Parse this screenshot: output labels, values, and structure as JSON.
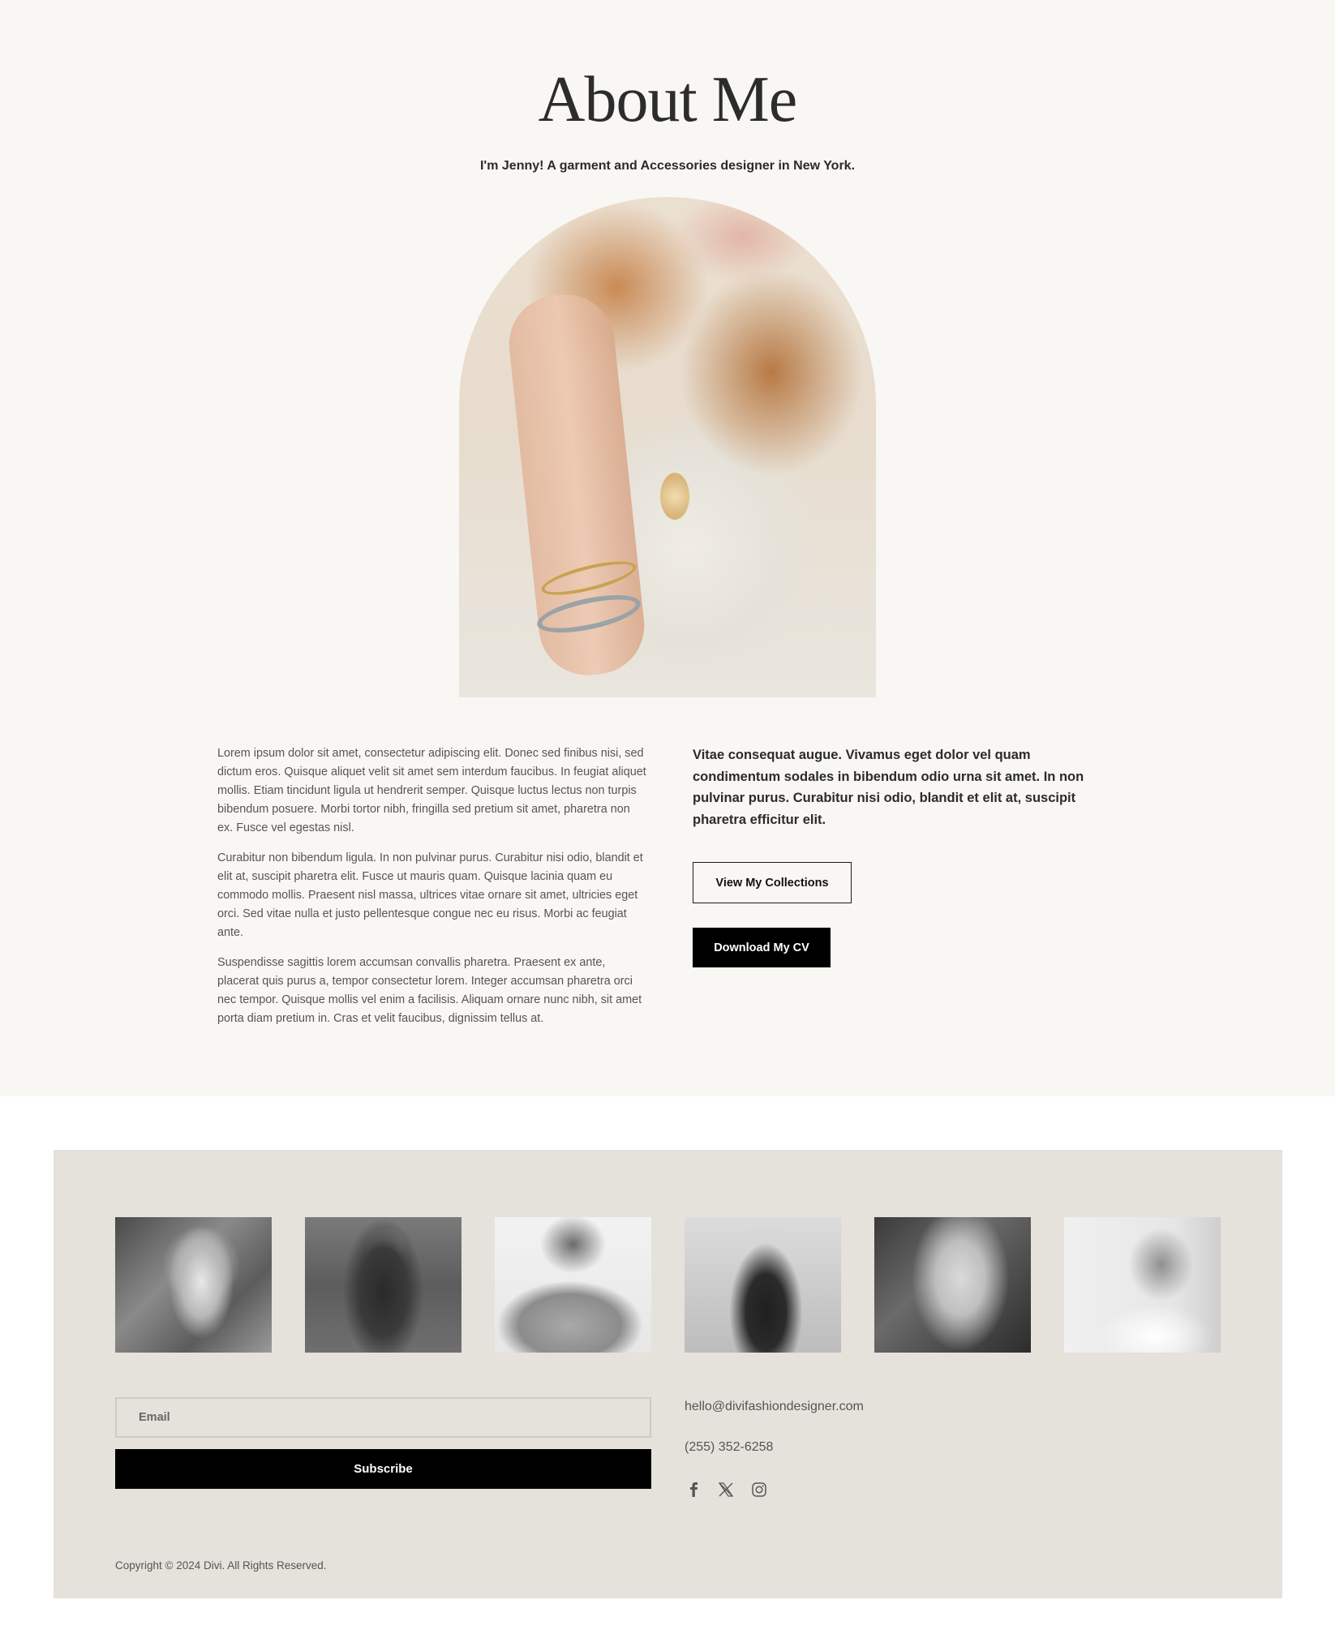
{
  "about": {
    "title": "About Me",
    "subtitle": "I'm Jenny! A garment and Accessories designer in New York.",
    "paragraphs": [
      "Lorem ipsum dolor sit amet, consectetur adipiscing elit. Donec sed finibus nisi, sed dictum eros. Quisque aliquet velit sit amet sem interdum faucibus. In feugiat aliquet mollis. Etiam tincidunt ligula ut hendrerit semper. Quisque luctus lectus non turpis bibendum posuere. Morbi tortor nibh, fringilla sed pretium sit amet, pharetra non ex. Fusce vel egestas nisl.",
      "Curabitur non bibendum ligula. In non pulvinar purus. Curabitur nisi odio, blandit et elit at, suscipit pharetra elit. Fusce ut mauris quam. Quisque lacinia quam eu commodo mollis. Praesent nisl massa, ultrices vitae ornare sit amet, ultricies eget orci. Sed vitae nulla et justo pellentesque congue nec eu risus. Morbi ac feugiat ante.",
      "Suspendisse sagittis lorem accumsan convallis pharetra. Praesent ex ante, placerat quis purus a, tempor consectetur lorem. Integer accumsan pharetra orci nec tempor. Quisque mollis vel enim a facilisis. Aliquam ornare nunc nibh, sit amet porta diam pretium in. Cras et velit faucibus, dignissim tellus at."
    ],
    "lead": "Vitae consequat augue. Vivamus eget dolor vel quam condimentum sodales in bibendum odio urna sit amet. In non pulvinar purus. Curabitur nisi odio, blandit et elit at, suscipit pharetra efficitur elit.",
    "collections_button": "View My Collections",
    "cv_button": "Download My CV"
  },
  "footer": {
    "email_placeholder": "Email",
    "subscribe_button": "Subscribe",
    "contact_email": "hello@divifashiondesigner.com",
    "contact_phone": "(255) 352-6258",
    "socials": [
      "facebook-icon",
      "x-icon",
      "instagram-icon"
    ],
    "copyright": "Copyright © 2024 Divi. All Rights Reserved."
  },
  "colors": {
    "page_bg": "#f9f7f4",
    "footer_bg": "#e5e2dc",
    "button_dark": "#000000",
    "text_dark": "#2b2b2b"
  }
}
